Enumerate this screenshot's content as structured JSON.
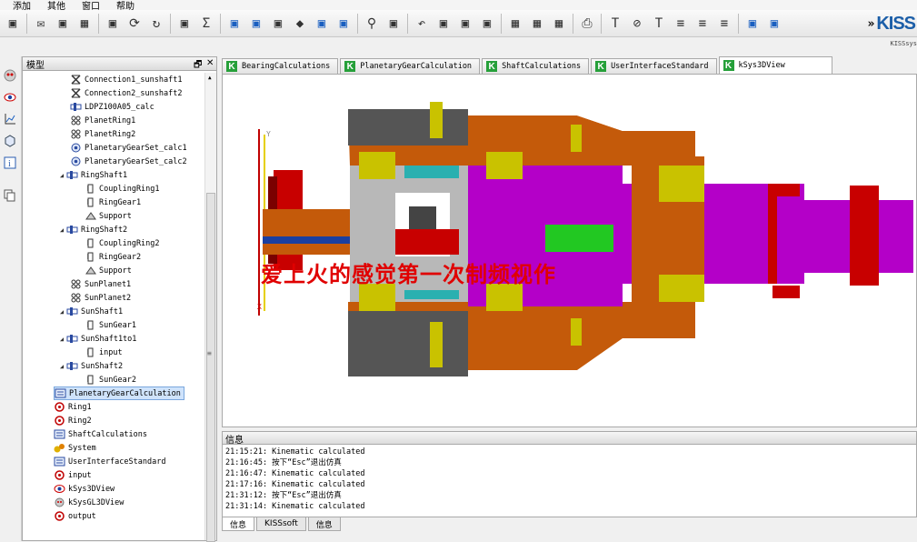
{
  "menu": [
    "添加",
    "其他",
    "窗口",
    "帮助"
  ],
  "brand": {
    "logo": "KISS",
    "subtitle": "KISSsys"
  },
  "panel": {
    "title": "模型",
    "float": "🗗",
    "close": "✕"
  },
  "tree": [
    {
      "indent": 2,
      "tw": "",
      "icon": "connection",
      "label": "Connection1_sunshaft1"
    },
    {
      "indent": 2,
      "tw": "",
      "icon": "connection",
      "label": "Connection2_sunshaft2"
    },
    {
      "indent": 2,
      "tw": "",
      "icon": "shaft",
      "label": "LDPZ100A05_calc"
    },
    {
      "indent": 2,
      "tw": "",
      "icon": "planet",
      "label": "PlanetRing1"
    },
    {
      "indent": 2,
      "tw": "",
      "icon": "planet",
      "label": "PlanetRing2"
    },
    {
      "indent": 2,
      "tw": "",
      "icon": "gearset",
      "label": "PlanetaryGearSet_calc1"
    },
    {
      "indent": 2,
      "tw": "",
      "icon": "gearset",
      "label": "PlanetaryGearSet_calc2"
    },
    {
      "indent": 1,
      "tw": "◢",
      "icon": "shaft",
      "label": "RingShaft1"
    },
    {
      "indent": 3,
      "tw": "",
      "icon": "gear",
      "label": "CouplingRing1"
    },
    {
      "indent": 3,
      "tw": "",
      "icon": "gear",
      "label": "RingGear1"
    },
    {
      "indent": 3,
      "tw": "",
      "icon": "support",
      "label": "Support"
    },
    {
      "indent": 1,
      "tw": "◢",
      "icon": "shaft",
      "label": "RingShaft2"
    },
    {
      "indent": 3,
      "tw": "",
      "icon": "gear",
      "label": "CouplingRing2"
    },
    {
      "indent": 3,
      "tw": "",
      "icon": "gear",
      "label": "RingGear2"
    },
    {
      "indent": 3,
      "tw": "",
      "icon": "support",
      "label": "Support"
    },
    {
      "indent": 2,
      "tw": "",
      "icon": "planet",
      "label": "SunPlanet1"
    },
    {
      "indent": 2,
      "tw": "",
      "icon": "planet",
      "label": "SunPlanet2"
    },
    {
      "indent": 1,
      "tw": "◢",
      "icon": "shaft",
      "label": "SunShaft1"
    },
    {
      "indent": 3,
      "tw": "",
      "icon": "gear",
      "label": "SunGear1"
    },
    {
      "indent": 1,
      "tw": "◢",
      "icon": "shaft",
      "label": "SunShaft1to1"
    },
    {
      "indent": 3,
      "tw": "",
      "icon": "gear",
      "label": "input"
    },
    {
      "indent": 1,
      "tw": "◢",
      "icon": "shaft",
      "label": "SunShaft2"
    },
    {
      "indent": 3,
      "tw": "",
      "icon": "gear",
      "label": "SunGear2"
    },
    {
      "indent": 0,
      "tw": "",
      "icon": "calc",
      "label": "PlanetaryGearCalculation",
      "selected": true
    },
    {
      "indent": 0,
      "tw": "",
      "icon": "red-gear",
      "label": "Ring1"
    },
    {
      "indent": 0,
      "tw": "",
      "icon": "red-gear",
      "label": "Ring2"
    },
    {
      "indent": 0,
      "tw": "",
      "icon": "calc",
      "label": "ShaftCalculations"
    },
    {
      "indent": 0,
      "tw": "",
      "icon": "system",
      "label": "System"
    },
    {
      "indent": 0,
      "tw": "",
      "icon": "calc",
      "label": "UserInterfaceStandard"
    },
    {
      "indent": 0,
      "tw": "",
      "icon": "red-gear",
      "label": "input"
    },
    {
      "indent": 0,
      "tw": "",
      "icon": "eye",
      "label": "kSys3DView"
    },
    {
      "indent": 0,
      "tw": "",
      "icon": "robot",
      "label": "kSysGL3DView"
    },
    {
      "indent": 0,
      "tw": "",
      "icon": "red-gear",
      "label": "output"
    }
  ],
  "tabs": [
    {
      "label": "BearingCalculations"
    },
    {
      "label": "PlanetaryGearCalculation"
    },
    {
      "label": "ShaftCalculations"
    },
    {
      "label": "UserInterfaceStandard"
    },
    {
      "label": "kSys3DView",
      "active": true
    }
  ],
  "view": {
    "overlay_text": "爱上火的感觉第一次制频视作",
    "axis_y": "Y",
    "axis_x": "X"
  },
  "info": {
    "title": "信息",
    "lines": [
      "21:15:21: Kinematic calculated",
      "21:16:45: 按下“Esc”退出仿真",
      "21:16:47: Kinematic calculated",
      "21:17:16: Kinematic calculated",
      "21:31:12: 按下“Esc”退出仿真",
      "21:31:14: Kinematic calculated"
    ]
  },
  "bottom_tabs": [
    {
      "label": "信息",
      "active": true
    },
    {
      "label": "KISSsoft"
    },
    {
      "label": "信息"
    }
  ],
  "colors": {
    "orange": "#c45a0a",
    "magenta": "#b400c8",
    "yellow": "#c9c200",
    "red": "#c80000",
    "gray": "#555555",
    "cyan": "#2ab0b0",
    "green": "#22c822"
  }
}
